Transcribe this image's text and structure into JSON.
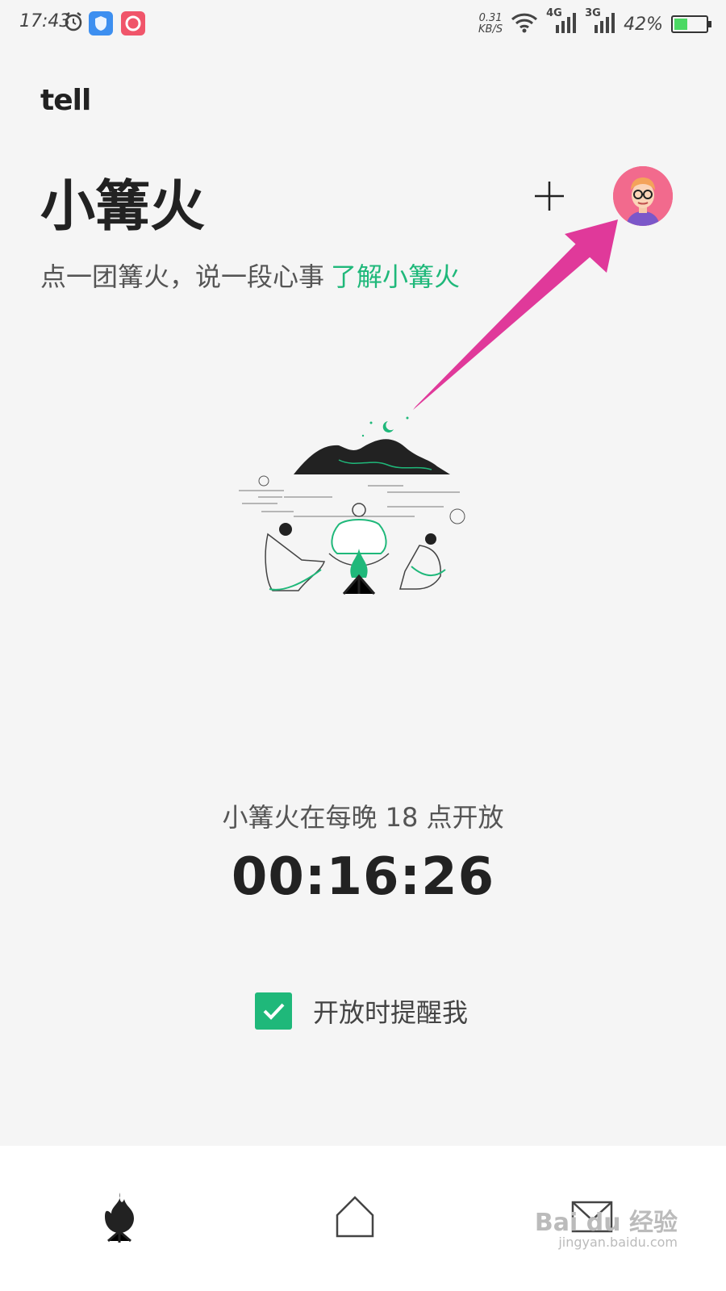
{
  "status_bar": {
    "time": "17:43",
    "net_speed_value": "0.31",
    "net_speed_unit": "KB/S",
    "net1": "4G",
    "net2": "3G",
    "battery_text": "42%",
    "battery_level": 0.42
  },
  "app": {
    "logo": "tell"
  },
  "header": {
    "title": "小篝火",
    "subtitle": "点一团篝火，说一段心事",
    "learn_more_link": "了解小篝火"
  },
  "schedule": {
    "open_text": "小篝火在每晚 18 点开放",
    "countdown": "00:16:26"
  },
  "reminder": {
    "label": "开放时提醒我",
    "checked": true
  },
  "colors": {
    "accent": "#1fb87a",
    "arrow": "#e0399a",
    "avatar_bg": "#f26a8d"
  },
  "watermark": {
    "text": "Bai du 经验",
    "sub": "jingyan.baidu.com"
  },
  "bottom_nav": [
    {
      "name": "bonfire-tab",
      "icon": "flame-icon",
      "active": true
    },
    {
      "name": "home-tab",
      "icon": "home-icon",
      "active": false
    },
    {
      "name": "mail-tab",
      "icon": "mail-icon",
      "active": false
    }
  ]
}
